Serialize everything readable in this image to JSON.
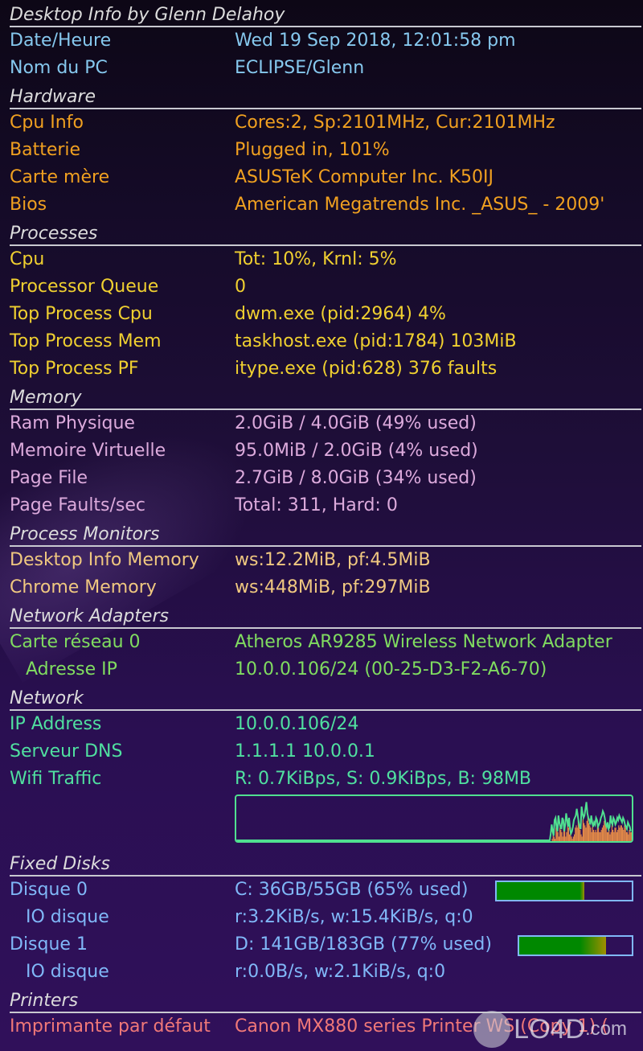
{
  "title": "Desktop Info by Glenn Delahoy",
  "top": [
    {
      "label": "Date/Heure",
      "value": "Wed 19 Sep 2018, 12:01:58 pm"
    },
    {
      "label": "Nom du PC",
      "value": "ECLIPSE/Glenn"
    }
  ],
  "hardware": {
    "heading": "Hardware",
    "rows": [
      {
        "label": "Cpu Info",
        "value": "Cores:2, Sp:2101MHz, Cur:2101MHz"
      },
      {
        "label": "Batterie",
        "value": "Plugged in, 101%"
      },
      {
        "label": "Carte mère",
        "value": "ASUSTeK Computer Inc. K50IJ"
      },
      {
        "label": "Bios",
        "value": "American Megatrends Inc. _ASUS_ - 2009'"
      }
    ]
  },
  "processes": {
    "heading": "Processes",
    "rows": [
      {
        "label": "Cpu",
        "value": "Tot: 10%, Krnl: 5%"
      },
      {
        "label": "Processor Queue",
        "value": "0"
      },
      {
        "label": "Top Process Cpu",
        "value": "dwm.exe (pid:2964) 4%"
      },
      {
        "label": "Top Process Mem",
        "value": "taskhost.exe (pid:1784) 103MiB"
      },
      {
        "label": "Top Process PF",
        "value": "itype.exe (pid:628) 376 faults"
      }
    ]
  },
  "memory": {
    "heading": "Memory",
    "rows": [
      {
        "label": "Ram Physique",
        "value": "2.0GiB / 4.0GiB (49% used)"
      },
      {
        "label": "Memoire Virtuelle",
        "value": "95.0MiB / 2.0GiB (4% used)"
      },
      {
        "label": "Page File",
        "value": "2.7GiB / 8.0GiB (34% used)"
      },
      {
        "label": "Page Faults/sec",
        "value": "Total: 311, Hard: 0"
      }
    ]
  },
  "process_monitors": {
    "heading": "Process Monitors",
    "rows": [
      {
        "label": "Desktop Info Memory",
        "value": "ws:12.2MiB, pf:4.5MiB"
      },
      {
        "label": "Chrome Memory",
        "value": "ws:448MiB, pf:297MiB"
      }
    ]
  },
  "network_adapters": {
    "heading": "Network Adapters",
    "rows": [
      {
        "label": "Carte réseau 0",
        "value": "Atheros AR9285 Wireless Network Adapter"
      },
      {
        "label": "Adresse IP",
        "value": "10.0.0.106/24 (00-25-D3-F2-A6-70)"
      }
    ]
  },
  "network": {
    "heading": "Network",
    "rows": [
      {
        "label": "IP Address",
        "value": "10.0.0.106/24"
      },
      {
        "label": "Serveur DNS",
        "value": "1.1.1.1 10.0.0.1"
      },
      {
        "label": "Wifi Traffic",
        "value": "R: 0.7KiBps, S: 0.9KiBps, B: 98MB"
      }
    ],
    "traffic_graph": {
      "receive_color": "#e08848",
      "send_color": "#50e090",
      "send": [
        0,
        0,
        0,
        0,
        0,
        0,
        0,
        0,
        0,
        0,
        0,
        0,
        0,
        0,
        0,
        0,
        0,
        0,
        0,
        0,
        0,
        0,
        0,
        0,
        0,
        0,
        0,
        0,
        0,
        0,
        0,
        0,
        0,
        0,
        0,
        0,
        0,
        0,
        0,
        0,
        0,
        0,
        0,
        0,
        0,
        0,
        0,
        0,
        0,
        0,
        0,
        0,
        0,
        0,
        0,
        0,
        0,
        0,
        0,
        0,
        0,
        0,
        0,
        0,
        0,
        0,
        0,
        0,
        0,
        0,
        0,
        0,
        0,
        0,
        0,
        0,
        0,
        0,
        0,
        0,
        0,
        0,
        0,
        0,
        0,
        0,
        0,
        0,
        0,
        0,
        0,
        0,
        0,
        0,
        0,
        0,
        0,
        0,
        0,
        0,
        0,
        0,
        0,
        0,
        0,
        0,
        0,
        0,
        0,
        0,
        0,
        0,
        0,
        0,
        0,
        0,
        0,
        0,
        0,
        0,
        0,
        0,
        0,
        0,
        0,
        0,
        0,
        0,
        0,
        0,
        0,
        0,
        0,
        0,
        0,
        0,
        0,
        0,
        0,
        0,
        0,
        0,
        0,
        0,
        0,
        0,
        0,
        0,
        0,
        0,
        0,
        0,
        0,
        0,
        0,
        0,
        0,
        0,
        0,
        0,
        0,
        0,
        0,
        0,
        0,
        0,
        0,
        0,
        0,
        0,
        0,
        0,
        0,
        0,
        0,
        0,
        0,
        0,
        0,
        0,
        0,
        0,
        0,
        0,
        0,
        0,
        0,
        0,
        0,
        0,
        0,
        0,
        0,
        0,
        0,
        0,
        0,
        0,
        0,
        0,
        0,
        0,
        0,
        0,
        0,
        0,
        0,
        0,
        0,
        0,
        0,
        0,
        0,
        0,
        0,
        0,
        0,
        0,
        0,
        0,
        0,
        0,
        0,
        0,
        0,
        0,
        0,
        0,
        0,
        0,
        0,
        0,
        0,
        0,
        0,
        0,
        0,
        0,
        0,
        0,
        0,
        0,
        0,
        0,
        0,
        0,
        0,
        0,
        0,
        0,
        0,
        0,
        0,
        0,
        0,
        0,
        0,
        0,
        0,
        0,
        0,
        0,
        0,
        0,
        0,
        0,
        0,
        0,
        0,
        0,
        0,
        0,
        0,
        0,
        0,
        0,
        0,
        0,
        0,
        0,
        0,
        0,
        0,
        0,
        0,
        0,
        0,
        0,
        0,
        0,
        0,
        0,
        0,
        0,
        0,
        0,
        0,
        0,
        0,
        0,
        0,
        0,
        0,
        0,
        0,
        0,
        0,
        0,
        0,
        0,
        0,
        0,
        0,
        0,
        0,
        0,
        0,
        0,
        0,
        0,
        0,
        0,
        0,
        0,
        0,
        0,
        0.15,
        0.35,
        0.2,
        0.1,
        0.45,
        0.5,
        0.3,
        0.2,
        0.55,
        0.4,
        0.3,
        0.25,
        0.5,
        0.45,
        0.2,
        0.35,
        0.6,
        0.45,
        0.3,
        0.5,
        0.25,
        0.15,
        0.2,
        0.3,
        0.45,
        0.5,
        0.55,
        0.7,
        0.55,
        0.4,
        0.3,
        0.25,
        0.75,
        0.6,
        0.5,
        0.55,
        0.7,
        0.85,
        0.6,
        0.5,
        0.45,
        0.35,
        0.55,
        0.4,
        0.3,
        0.4,
        0.35,
        0.5,
        0.45,
        0.3,
        0.35,
        0.4,
        0.5,
        0.55,
        0.65,
        0.6,
        0.5,
        0.35,
        0.3,
        0.4,
        0.25,
        0.3,
        0.55,
        0.4,
        0.35,
        0.5,
        0.45,
        0.35,
        0.4,
        0.5,
        0.45,
        0.55,
        0.5,
        0.45,
        0.4,
        0.5,
        0.45,
        0.35,
        0.3,
        0.25,
        0.4,
        0.35,
        0.3,
        0.2
      ],
      "receive": [
        0,
        0,
        0,
        0,
        0,
        0,
        0,
        0,
        0,
        0,
        0,
        0,
        0,
        0,
        0,
        0,
        0,
        0,
        0,
        0,
        0,
        0,
        0,
        0,
        0,
        0,
        0,
        0,
        0,
        0,
        0,
        0,
        0,
        0,
        0,
        0,
        0,
        0,
        0,
        0,
        0,
        0,
        0,
        0,
        0,
        0,
        0,
        0,
        0,
        0,
        0,
        0,
        0,
        0,
        0,
        0,
        0,
        0,
        0,
        0,
        0,
        0,
        0,
        0,
        0,
        0,
        0,
        0,
        0,
        0,
        0,
        0,
        0,
        0,
        0,
        0,
        0,
        0,
        0,
        0,
        0,
        0,
        0,
        0,
        0,
        0,
        0,
        0,
        0,
        0,
        0,
        0,
        0,
        0,
        0,
        0,
        0,
        0,
        0,
        0,
        0,
        0,
        0,
        0,
        0,
        0,
        0,
        0,
        0,
        0,
        0,
        0,
        0,
        0,
        0,
        0,
        0,
        0,
        0,
        0,
        0,
        0,
        0,
        0,
        0,
        0,
        0,
        0,
        0,
        0,
        0,
        0,
        0,
        0,
        0,
        0,
        0,
        0,
        0,
        0,
        0,
        0,
        0,
        0,
        0,
        0,
        0,
        0,
        0,
        0,
        0,
        0,
        0,
        0,
        0,
        0,
        0,
        0,
        0,
        0,
        0,
        0,
        0,
        0,
        0,
        0,
        0,
        0,
        0,
        0,
        0,
        0,
        0,
        0,
        0,
        0,
        0,
        0,
        0,
        0,
        0,
        0,
        0,
        0,
        0,
        0,
        0,
        0,
        0,
        0,
        0,
        0,
        0,
        0,
        0,
        0,
        0,
        0,
        0,
        0,
        0,
        0,
        0,
        0,
        0,
        0,
        0,
        0,
        0,
        0,
        0,
        0,
        0,
        0,
        0,
        0,
        0,
        0,
        0,
        0,
        0,
        0,
        0,
        0,
        0,
        0,
        0,
        0,
        0,
        0,
        0,
        0,
        0,
        0,
        0,
        0,
        0,
        0,
        0,
        0,
        0,
        0,
        0,
        0,
        0,
        0,
        0,
        0,
        0,
        0,
        0,
        0,
        0,
        0,
        0,
        0,
        0,
        0,
        0,
        0,
        0,
        0,
        0,
        0,
        0,
        0,
        0,
        0,
        0,
        0,
        0,
        0,
        0,
        0,
        0,
        0,
        0,
        0,
        0,
        0,
        0,
        0,
        0,
        0,
        0,
        0,
        0,
        0,
        0,
        0,
        0,
        0,
        0,
        0,
        0,
        0,
        0,
        0,
        0,
        0,
        0,
        0,
        0,
        0,
        0,
        0,
        0,
        0,
        0,
        0,
        0,
        0,
        0,
        0,
        0,
        0,
        0,
        0,
        0,
        0,
        0,
        0,
        0,
        0,
        0,
        0,
        0,
        0.05,
        0.2,
        0.1,
        0.05,
        0.3,
        0.35,
        0.2,
        0.1,
        0.3,
        0.25,
        0.2,
        0.1,
        0.3,
        0.3,
        0.1,
        0.2,
        0.4,
        0.3,
        0.15,
        0.3,
        0.1,
        0.05,
        0.1,
        0.15,
        0.3,
        0.35,
        0.3,
        0.45,
        0.35,
        0.25,
        0.15,
        0.1,
        0.5,
        0.4,
        0.35,
        0.3,
        0.45,
        0.55,
        0.4,
        0.35,
        0.3,
        0.2,
        0.35,
        0.25,
        0.2,
        0.25,
        0.2,
        0.35,
        0.3,
        0.2,
        0.2,
        0.25,
        0.3,
        0.35,
        0.45,
        0.4,
        0.35,
        0.2,
        0.2,
        0.25,
        0.15,
        0.2,
        0.35,
        0.25,
        0.2,
        0.3,
        0.3,
        0.2,
        0.25,
        0.35,
        0.3,
        0.35,
        0.35,
        0.3,
        0.25,
        0.35,
        0.3,
        0.2,
        0.2,
        0.15,
        0.25,
        0.2,
        0.2,
        0.1
      ]
    }
  },
  "fixed_disks": {
    "heading": "Fixed Disks",
    "rows": [
      {
        "label": "Disque 0",
        "value": "C: 36GB/55GB (65% used)",
        "usage": 0.65,
        "indent": false,
        "bar": true
      },
      {
        "label": "IO disque",
        "value": "r:3.2KiB/s, w:15.4KiB/s, q:0",
        "indent": true,
        "bar": false
      },
      {
        "label": "Disque 1",
        "value": "D: 141GB/183GB (77% used)",
        "usage": 0.77,
        "indent": false,
        "bar": true
      },
      {
        "label": "IO disque",
        "value": "r:0.0B/s, w:2.1KiB/s, q:0",
        "indent": true,
        "bar": false
      }
    ],
    "bar_color": "#008800",
    "bar_warn_color": "#a09000"
  },
  "printers": {
    "heading": "Printers",
    "rows": [
      {
        "label": "Imprimante par défaut",
        "value": "Canon MX880 series Printer WS (Copy 1) ("
      }
    ]
  },
  "watermark": {
    "brand": "LO4D",
    "suffix": ".com"
  }
}
